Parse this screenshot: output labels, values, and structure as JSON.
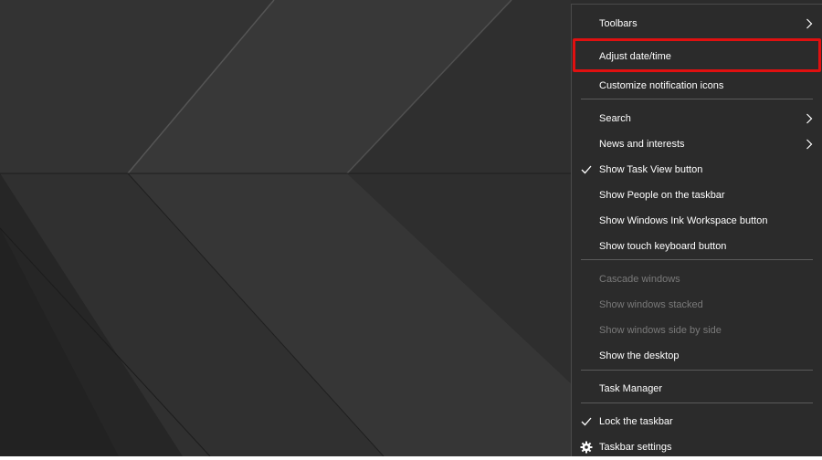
{
  "context_menu": {
    "items": [
      {
        "label": "Toolbars",
        "enabled": true,
        "checked": false,
        "submenu": true
      },
      {
        "label": "Adjust date/time",
        "enabled": true,
        "checked": false,
        "submenu": false,
        "highlighted": true
      },
      {
        "label": "Customize notification icons",
        "enabled": true,
        "checked": false,
        "submenu": false
      },
      {
        "label": "Search",
        "enabled": true,
        "checked": false,
        "submenu": true
      },
      {
        "label": "News and interests",
        "enabled": true,
        "checked": false,
        "submenu": true
      },
      {
        "label": "Show Task View button",
        "enabled": true,
        "checked": true,
        "submenu": false
      },
      {
        "label": "Show People on the taskbar",
        "enabled": true,
        "checked": false,
        "submenu": false
      },
      {
        "label": "Show Windows Ink Workspace button",
        "enabled": true,
        "checked": false,
        "submenu": false
      },
      {
        "label": "Show touch keyboard button",
        "enabled": true,
        "checked": false,
        "submenu": false
      },
      {
        "label": "Cascade windows",
        "enabled": false,
        "checked": false,
        "submenu": false
      },
      {
        "label": "Show windows stacked",
        "enabled": false,
        "checked": false,
        "submenu": false
      },
      {
        "label": "Show windows side by side",
        "enabled": false,
        "checked": false,
        "submenu": false
      },
      {
        "label": "Show the desktop",
        "enabled": true,
        "checked": false,
        "submenu": false
      },
      {
        "label": "Task Manager",
        "enabled": true,
        "checked": false,
        "submenu": false
      },
      {
        "label": "Lock the taskbar",
        "enabled": true,
        "checked": true,
        "submenu": false
      },
      {
        "label": "Taskbar settings",
        "enabled": true,
        "checked": false,
        "submenu": false,
        "icon": "gear-icon"
      }
    ]
  },
  "colors": {
    "menu_background": "#2b2b2b",
    "text": "#ffffff",
    "disabled_text": "#7a7a7a",
    "highlight_border": "#e01010",
    "separator": "#5a5a5a"
  }
}
